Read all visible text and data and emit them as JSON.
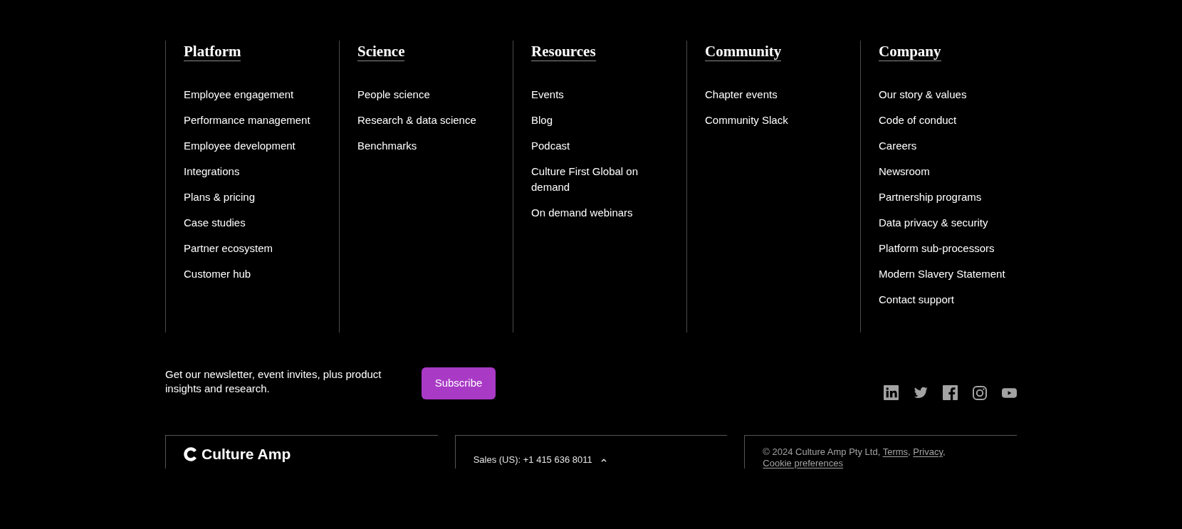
{
  "columns": [
    {
      "heading": "Platform",
      "links": [
        "Employee engagement",
        "Performance management",
        "Employee development",
        "Integrations",
        "Plans & pricing",
        "Case studies",
        "Partner ecosystem",
        "Customer hub"
      ]
    },
    {
      "heading": "Science",
      "links": [
        "People science",
        "Research & data science",
        "Benchmarks"
      ]
    },
    {
      "heading": "Resources",
      "links": [
        "Events",
        "Blog",
        "Podcast",
        "Culture First Global on demand",
        "On demand webinars"
      ]
    },
    {
      "heading": "Community",
      "links": [
        "Chapter events",
        "Community Slack"
      ]
    },
    {
      "heading": "Company",
      "links": [
        "Our story & values",
        "Code of conduct",
        "Careers",
        "Newsroom",
        "Partnership programs",
        "Data privacy & security",
        "Platform sub-processors",
        "Modern Slavery Statement",
        "Contact support"
      ]
    }
  ],
  "newsletter": {
    "text": "Get our newsletter, event invites, plus product insights and research.",
    "button": "Subscribe"
  },
  "social_links": [
    {
      "kind": "linkedin"
    },
    {
      "kind": "twitter"
    },
    {
      "kind": "facebook"
    },
    {
      "kind": "instagram"
    },
    {
      "kind": "youtube"
    }
  ],
  "logo": {
    "text": "Culture Amp"
  },
  "sales": {
    "label": "Sales (US): +1 415 636 8011"
  },
  "legal": [
    {
      "kind": "text",
      "text": "© 2024 Culture Amp Pty Ltd, "
    },
    {
      "kind": "link",
      "text": "Terms"
    },
    {
      "kind": "text",
      "text": ", "
    },
    {
      "kind": "link",
      "text": "Privacy"
    },
    {
      "kind": "text",
      "text": ", "
    },
    {
      "kind": "link",
      "text": "Cookie preferences"
    }
  ]
}
